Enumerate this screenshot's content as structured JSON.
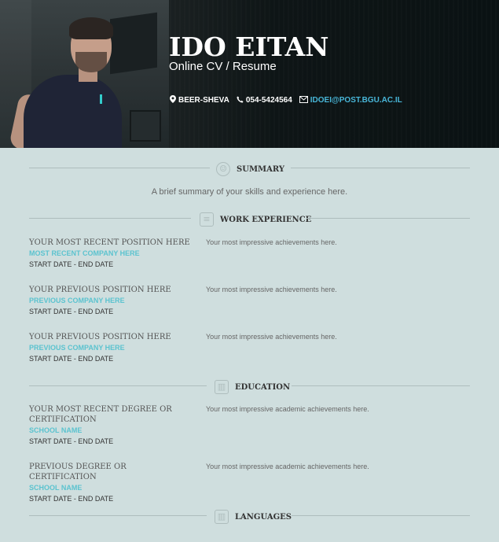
{
  "header": {
    "name": "IDO EITAN",
    "subtitle": "Online CV / Resume",
    "location": "BEER-SHEVA",
    "phone": "054-5424564",
    "email": "IDOEI@POST.BGU.AC.IL",
    "icons": [
      "map-marker-icon",
      "phone-icon",
      "envelope-icon"
    ]
  },
  "summary": {
    "title": "SUMMARY",
    "text": "A brief summary of your skills and experience here."
  },
  "work": {
    "title": "WORK EXPERIENCE",
    "items": [
      {
        "position": "YOUR MOST RECENT POSITION HERE",
        "company": "MOST RECENT COMPANY HERE",
        "start": "START DATE",
        "end": "END DATE",
        "desc": "Your most impressive achievements here."
      },
      {
        "position": "YOUR PREVIOUS POSITION HERE",
        "company": "PREVIOUS COMPANY HERE",
        "start": "START DATE",
        "end": "END DATE",
        "desc": "Your most impressive achievements here."
      },
      {
        "position": "YOUR PREVIOUS POSITION HERE",
        "company": "PREVIOUS COMPANY HERE",
        "start": "START DATE",
        "end": "END DATE",
        "desc": "Your most impressive achievements here."
      }
    ]
  },
  "education": {
    "title": "EDUCATION",
    "items": [
      {
        "position": "YOUR MOST RECENT DEGREE OR CERTIFICATION",
        "company": "SCHOOL NAME",
        "start": "START DATE",
        "end": "END DATE",
        "desc": "Your most impressive academic achievements here."
      },
      {
        "position": "PREVIOUS DEGREE OR CERTIFICATION",
        "company": "SCHOOL NAME",
        "start": "START DATE",
        "end": "END DATE",
        "desc": "Your most impressive academic achievements here."
      }
    ]
  },
  "languages": {
    "title": "LANGUAGES"
  },
  "colors": {
    "accent": "#5bc3cf",
    "email": "#48b6d8",
    "background": "#cfdede"
  }
}
